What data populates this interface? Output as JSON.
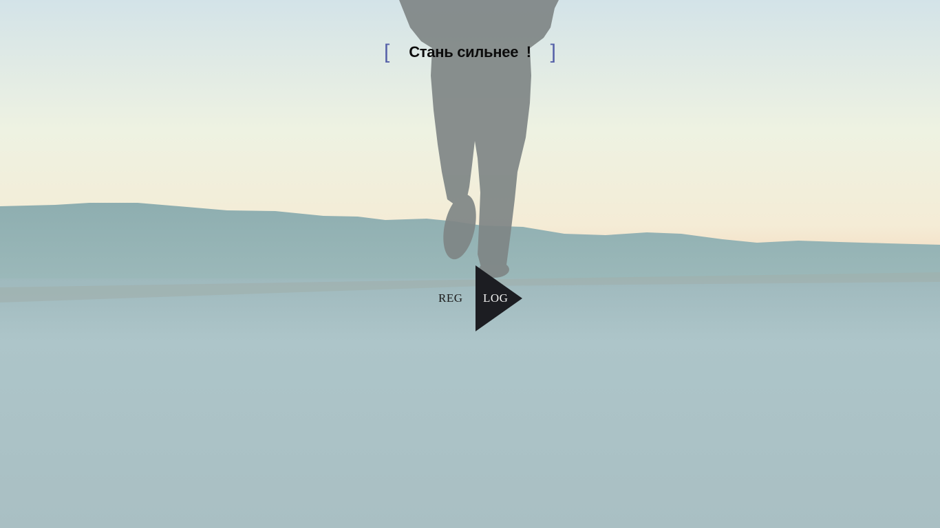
{
  "hero": {
    "bracket_open": "[",
    "slogan": "Стань сильнее  !",
    "bracket_close": "]"
  },
  "auth": {
    "reg_label": "REG",
    "log_label": "LOG",
    "icon": "play-triangle-icon"
  },
  "colors": {
    "bracket": "#5560a8",
    "slogan": "#0c0c0c",
    "triangle": "#1c1d22"
  }
}
